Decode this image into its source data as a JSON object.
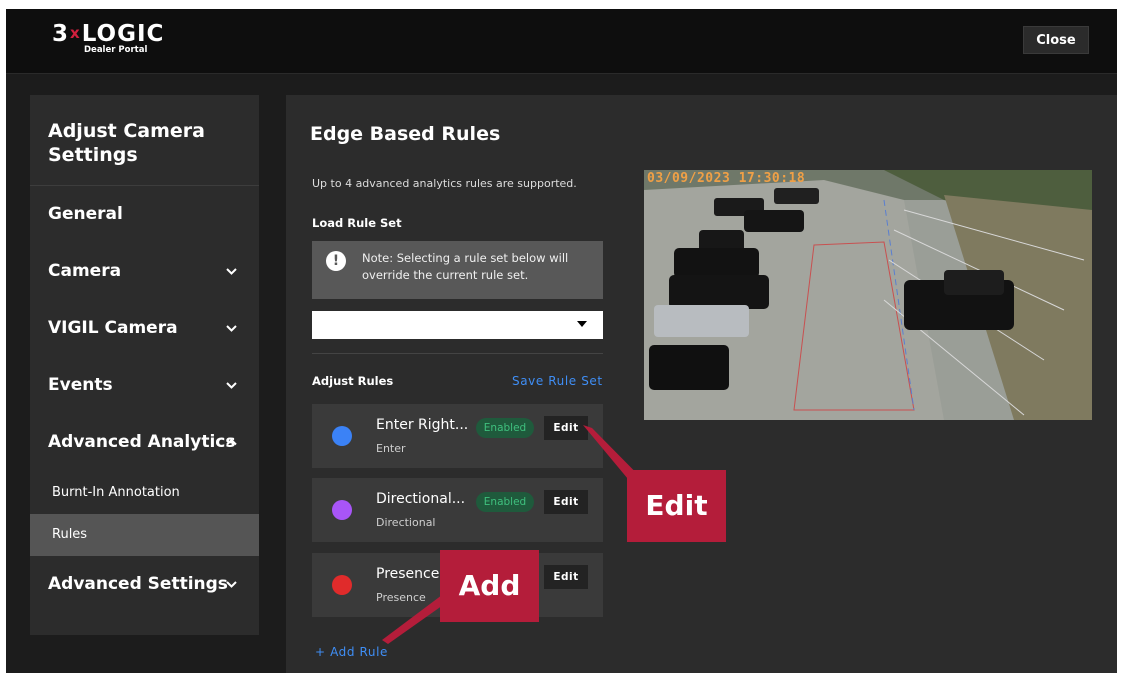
{
  "header": {
    "logo_main": "3",
    "logo_x": "x",
    "logo_rest": "LOGIC",
    "logo_sub": "Dealer Portal",
    "close_label": "Close"
  },
  "sidebar": {
    "title": "Adjust Camera Settings",
    "items": [
      {
        "label": "General",
        "expandable": false
      },
      {
        "label": "Camera",
        "expandable": true,
        "chevron": "⌄"
      },
      {
        "label": "VIGIL Camera",
        "expandable": true,
        "chevron": "⌄"
      },
      {
        "label": "Events",
        "expandable": true,
        "chevron": "⌄"
      },
      {
        "label": "Advanced Analytics",
        "expandable": true,
        "expanded": true,
        "chevron": "^"
      },
      {
        "label": "Advanced Settings",
        "expandable": true,
        "chevron": "⌄"
      }
    ],
    "sub_items": [
      {
        "label": "Burnt-In Annotation",
        "active": false
      },
      {
        "label": "Rules",
        "active": true
      }
    ]
  },
  "main": {
    "title": "Edge Based Rules",
    "info": "Up to 4 advanced analytics rules are supported.",
    "load_label": "Load Rule Set",
    "note_icon": "!",
    "note": "Note: Selecting a rule set below will override the current rule set.",
    "select_value": "",
    "adjust_label": "Adjust Rules",
    "save_label": "Save Rule Set",
    "add_rule_label": "+ Add Rule",
    "rules": [
      {
        "name": "Enter Right...",
        "type": "Enter",
        "color": "#3b82f6",
        "status": "Enabled",
        "edit": "Edit"
      },
      {
        "name": "Directional...",
        "type": "Directional",
        "color": "#a855f7",
        "status": "Enabled",
        "edit": "Edit"
      },
      {
        "name": "Presence",
        "type": "Presence",
        "color": "#e02b2b",
        "status": "",
        "edit": "Edit"
      }
    ]
  },
  "camera": {
    "timestamp": "03/09/2023 17:30:18"
  },
  "callouts": {
    "edit": "Edit",
    "add": "Add"
  },
  "colors": {
    "accent_blue": "#3f8ef5",
    "callout_red": "#b41d3a",
    "enabled_green": "#3fc07e"
  }
}
